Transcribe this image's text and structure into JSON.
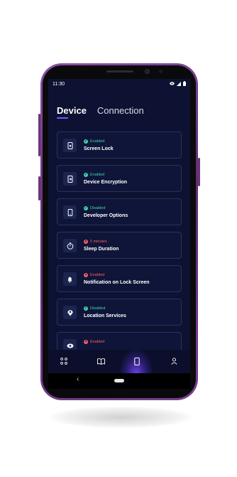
{
  "status_bar": {
    "time": "11:30"
  },
  "tabs": [
    {
      "label": "Device",
      "active": true
    },
    {
      "label": "Connection",
      "active": false
    }
  ],
  "settings": [
    {
      "status": "Enabled",
      "state": "ok",
      "title": "Screen Lock",
      "icon": "phone-lock-icon"
    },
    {
      "status": "Enabled",
      "state": "ok",
      "title": "Device Encryption",
      "icon": "encryption-icon"
    },
    {
      "status": "Disabled",
      "state": "ok",
      "title": "Developer Options",
      "icon": "smartphone-icon"
    },
    {
      "status": "5 minutes",
      "state": "bad",
      "title": "Sleep Duration",
      "icon": "timer-icon"
    },
    {
      "status": "Enabled",
      "state": "bad",
      "title": "Notification on Lock Screen",
      "icon": "bell-icon"
    },
    {
      "status": "Disabled",
      "state": "ok",
      "title": "Location Services",
      "icon": "location-pin-icon"
    },
    {
      "status": "Enabled",
      "state": "bad",
      "title": "",
      "icon": "eye-icon"
    }
  ],
  "bottom_nav": [
    {
      "icon": "apps-grid-icon",
      "active": false
    },
    {
      "icon": "book-icon",
      "active": false
    },
    {
      "icon": "device-icon",
      "active": true
    },
    {
      "icon": "user-icon",
      "active": false
    }
  ],
  "colors": {
    "background": "#0d1232",
    "ok": "#3fd6b0",
    "bad": "#ff5b6b",
    "accent": "#6c5cff",
    "phone_frame": "#7b3f8d"
  }
}
